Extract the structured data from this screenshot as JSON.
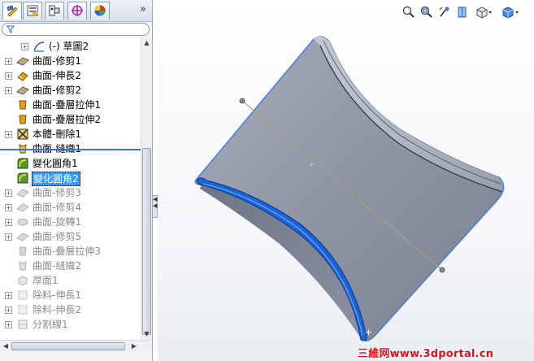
{
  "feature_manager": {
    "tabs": [
      {
        "name": "feature-tree-tab",
        "icon": "feature-tree-icon"
      },
      {
        "name": "property-tab",
        "icon": "property-manager-icon"
      },
      {
        "name": "config-tab",
        "icon": "configuration-manager-icon"
      },
      {
        "name": "dimxpert-tab",
        "icon": "dimxpert-icon"
      },
      {
        "name": "display-tab",
        "icon": "display-manager-icon"
      }
    ],
    "more_tabs_glyph": "»",
    "filter_icon": "filter-icon",
    "tree_items": [
      {
        "label": "(-) 草圖2",
        "icon": "sketch-icon",
        "expander": "+",
        "state": "normal"
      },
      {
        "label": "曲面-修剪1",
        "icon": "surface-trim-icon",
        "expander": "+",
        "state": "normal"
      },
      {
        "label": "曲面-伸長2",
        "icon": "surface-extend-icon",
        "expander": "+",
        "state": "normal"
      },
      {
        "label": "曲面-修剪2",
        "icon": "surface-trim-icon",
        "expander": "+",
        "state": "normal"
      },
      {
        "label": "曲面-疊層拉伸1",
        "icon": "surface-loft-icon",
        "expander": "",
        "state": "normal"
      },
      {
        "label": "曲面-疊層拉伸2",
        "icon": "surface-loft-icon",
        "expander": "",
        "state": "normal"
      },
      {
        "label": "本體-刪除1",
        "icon": "delete-body-icon",
        "expander": "+",
        "state": "normal"
      },
      {
        "label": "曲面-縫織1",
        "icon": "surface-knit-icon",
        "expander": "",
        "state": "normal"
      },
      {
        "label": "變化圓角1",
        "icon": "variable-fillet-icon",
        "expander": "",
        "state": "normal"
      },
      {
        "label": "變化圓角2",
        "icon": "variable-fillet-icon",
        "expander": "",
        "state": "selected"
      },
      {
        "label": "曲面-修剪3",
        "icon": "surface-trim-icon",
        "expander": "+",
        "state": "suppressed"
      },
      {
        "label": "曲面-修剪4",
        "icon": "surface-trim-icon",
        "expander": "+",
        "state": "suppressed"
      },
      {
        "label": "曲面-旋轉1",
        "icon": "surface-revolve-icon",
        "expander": "+",
        "state": "suppressed"
      },
      {
        "label": "曲面-修剪5",
        "icon": "surface-trim-icon",
        "expander": "+",
        "state": "suppressed"
      },
      {
        "label": "曲面-疊層拉伸3",
        "icon": "surface-loft-icon",
        "expander": "",
        "state": "suppressed"
      },
      {
        "label": "曲面-縫織2",
        "icon": "surface-knit-icon",
        "expander": "",
        "state": "suppressed"
      },
      {
        "label": "厚面1",
        "icon": "thicken-icon",
        "expander": "",
        "state": "suppressed"
      },
      {
        "label": "除料-伸長1",
        "icon": "extruded-cut-icon",
        "expander": "+",
        "state": "suppressed"
      },
      {
        "label": "除料-伸長2",
        "icon": "extruded-cut-icon",
        "expander": "+",
        "state": "suppressed"
      },
      {
        "label": "分割線1",
        "icon": "split-line-icon",
        "expander": "+",
        "state": "suppressed"
      }
    ]
  },
  "heads_up_toolbar": [
    {
      "name": "zoom-to-fit-button",
      "icon": "zoom-to-fit-icon"
    },
    {
      "name": "zoom-to-area-button",
      "icon": "zoom-to-area-icon"
    },
    {
      "name": "previous-view-button",
      "icon": "previous-view-icon"
    },
    {
      "name": "section-view-button",
      "icon": "section-view-icon"
    },
    {
      "name": "view-orientation-button",
      "icon": "view-orientation-icon"
    },
    {
      "name": "display-style-button",
      "icon": "display-style-icon"
    }
  ],
  "colors": {
    "selection": "#3399ff",
    "model_face": "#8f95a3",
    "highlight_edge": "#1a64d8",
    "watermark": "#e0101a"
  },
  "watermark": "三維网www.3dportal.cn"
}
